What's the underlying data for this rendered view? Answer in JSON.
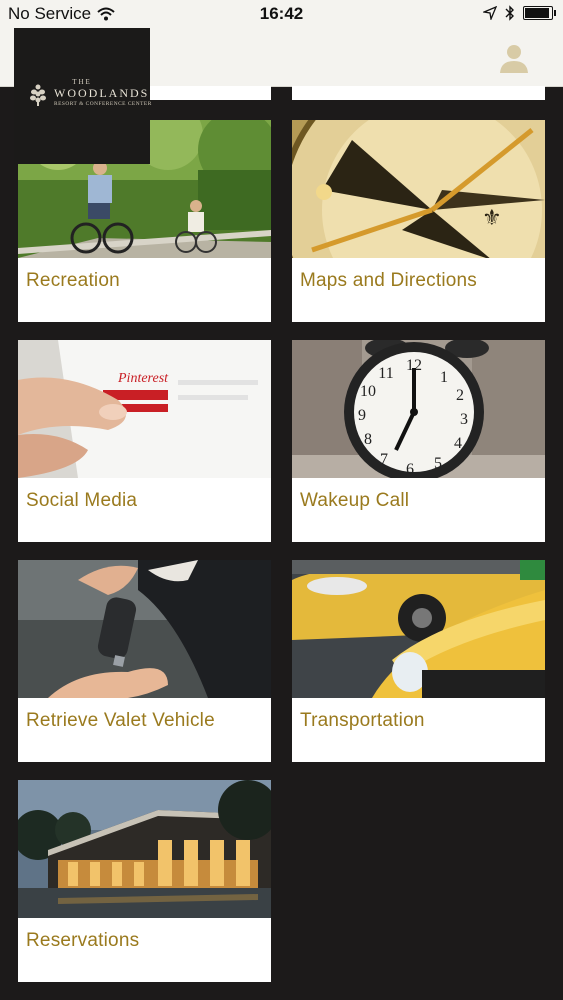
{
  "status_bar": {
    "carrier": "No Service",
    "time": "16:42"
  },
  "header": {
    "logo": {
      "small": "THE",
      "name": "WOODLANDS",
      "sub": "RESORT & CONFERENCE CENTER"
    },
    "profile_icon": "user-silhouette-icon"
  },
  "menu": {
    "items": [
      {
        "label": "Recreation",
        "image": "cyclists-on-trail"
      },
      {
        "label": "Maps and Directions",
        "image": "compass"
      },
      {
        "label": "Social Media",
        "image": "hand-touching-tablet"
      },
      {
        "label": "Wakeup Call",
        "image": "alarm-clock"
      },
      {
        "label": "Retrieve Valet Vehicle",
        "image": "car-key-handover"
      },
      {
        "label": "Transportation",
        "image": "yellow-taxis"
      },
      {
        "label": "Reservations",
        "image": "resort-building-at-dusk"
      }
    ]
  },
  "colors": {
    "accent_gold": "#9a7a1e",
    "background": "#1c1a1a",
    "header_bg": "#f4f3ef"
  }
}
